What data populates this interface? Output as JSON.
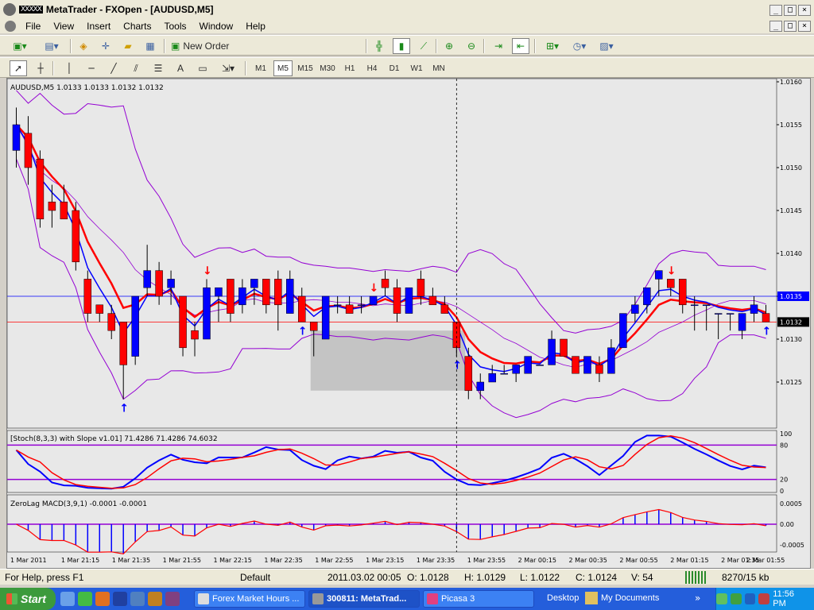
{
  "window": {
    "title": "MetaTrader - FXOpen - [AUDUSD,M5]",
    "title_mark": "XXXXX",
    "controls": {
      "minimize": "_",
      "restore": "□",
      "close": "×"
    }
  },
  "menu": [
    "File",
    "View",
    "Insert",
    "Charts",
    "Tools",
    "Window",
    "Help"
  ],
  "toolbar": {
    "new_order": "New Order",
    "timeframes": [
      "M1",
      "M5",
      "M15",
      "M30",
      "H1",
      "H4",
      "D1",
      "W1",
      "MN"
    ],
    "selected_timeframe": "M5"
  },
  "chart": {
    "symbol_info": "AUDUSD,M5  1.0133 1.0133 1.0132 1.0132",
    "stoch_label": "[Stoch(8,3,3) with Slope v1.01] 71.4286 71.4286 74.6032",
    "macd_label": "ZeroLag MACD(3,9,1) -0.0001 -0.0001",
    "price_ticks": [
      "1.0160",
      "1.0155",
      "1.0150",
      "1.0145",
      "1.0140",
      "1.0135",
      "1.0130",
      "1.0125"
    ],
    "current_price": "1.0132",
    "line_price_blue": "1.0135",
    "stoch_ticks": [
      "100",
      "80",
      "20",
      "0"
    ],
    "macd_ticks": [
      "0.0005",
      "0.00",
      "-0.0005"
    ],
    "time_ticks": [
      "1 Mar 2011",
      "1 Mar 21:15",
      "1 Mar 21:35",
      "1 Mar 21:55",
      "1 Mar 22:15",
      "1 Mar 22:35",
      "1 Mar 22:55",
      "1 Mar 23:15",
      "1 Mar 23:35",
      "1 Mar 23:55",
      "2 Mar 00:15",
      "2 Mar 00:35",
      "2 Mar 00:55",
      "2 Mar 01:15",
      "2 Mar 01:35",
      "2 Mar 01:55"
    ],
    "colors": {
      "bull": "#0000ff",
      "bear": "#ff0000",
      "band": "#9400d3",
      "ema": "#ff0000",
      "ema2": "#0000ff",
      "cyan": "#00e5ff"
    }
  },
  "chart_data": {
    "type": "candlestick",
    "symbol": "AUDUSD",
    "timeframe": "M5",
    "candles": [
      {
        "o": 1.0152,
        "h": 1.0157,
        "l": 1.015,
        "c": 1.0155
      },
      {
        "o": 1.0154,
        "h": 1.0156,
        "l": 1.0148,
        "c": 1.015
      },
      {
        "o": 1.0151,
        "h": 1.0152,
        "l": 1.0143,
        "c": 1.0144
      },
      {
        "o": 1.0146,
        "h": 1.0148,
        "l": 1.0143,
        "c": 1.0145
      },
      {
        "o": 1.0146,
        "h": 1.0148,
        "l": 1.0144,
        "c": 1.0144
      },
      {
        "o": 1.0145,
        "h": 1.0146,
        "l": 1.0138,
        "c": 1.0139
      },
      {
        "o": 1.0137,
        "h": 1.0138,
        "l": 1.0132,
        "c": 1.0133
      },
      {
        "o": 1.0134,
        "h": 1.0134,
        "l": 1.0132,
        "c": 1.0133
      },
      {
        "o": 1.0133,
        "h": 1.0134,
        "l": 1.013,
        "c": 1.0131
      },
      {
        "o": 1.0132,
        "h": 1.0132,
        "l": 1.0123,
        "c": 1.0127
      },
      {
        "o": 1.0128,
        "h": 1.0135,
        "l": 1.0127,
        "c": 1.0135
      },
      {
        "o": 1.0136,
        "h": 1.0141,
        "l": 1.0135,
        "c": 1.0138
      },
      {
        "o": 1.0138,
        "h": 1.0139,
        "l": 1.0134,
        "c": 1.0135
      },
      {
        "o": 1.0136,
        "h": 1.0138,
        "l": 1.0134,
        "c": 1.0137
      },
      {
        "o": 1.0135,
        "h": 1.0135,
        "l": 1.0128,
        "c": 1.0129
      },
      {
        "o": 1.0131,
        "h": 1.0132,
        "l": 1.0128,
        "c": 1.013
      },
      {
        "o": 1.013,
        "h": 1.0137,
        "l": 1.013,
        "c": 1.0136
      },
      {
        "o": 1.0135,
        "h": 1.0136,
        "l": 1.0132,
        "c": 1.0136
      },
      {
        "o": 1.0137,
        "h": 1.0137,
        "l": 1.0132,
        "c": 1.0133
      },
      {
        "o": 1.0134,
        "h": 1.0137,
        "l": 1.0133,
        "c": 1.0136
      },
      {
        "o": 1.0136,
        "h": 1.0137,
        "l": 1.0134,
        "c": 1.0137
      },
      {
        "o": 1.0137,
        "h": 1.0137,
        "l": 1.0133,
        "c": 1.0134
      },
      {
        "o": 1.0137,
        "h": 1.0138,
        "l": 1.0131,
        "c": 1.0134
      },
      {
        "o": 1.0133,
        "h": 1.0138,
        "l": 1.0133,
        "c": 1.0137
      },
      {
        "o": 1.0135,
        "h": 1.0136,
        "l": 1.0132,
        "c": 1.0132
      },
      {
        "o": 1.0132,
        "h": 1.0132,
        "l": 1.0128,
        "c": 1.0131
      },
      {
        "o": 1.013,
        "h": 1.0135,
        "l": 1.013,
        "c": 1.0135
      },
      {
        "o": 1.0134,
        "h": 1.0135,
        "l": 1.0133,
        "c": 1.0134
      },
      {
        "o": 1.0134,
        "h": 1.0135,
        "l": 1.0133,
        "c": 1.0133
      },
      {
        "o": 1.0134,
        "h": 1.0135,
        "l": 1.0133,
        "c": 1.0134
      },
      {
        "o": 1.0134,
        "h": 1.0135,
        "l": 1.0134,
        "c": 1.0135
      },
      {
        "o": 1.0137,
        "h": 1.0138,
        "l": 1.0135,
        "c": 1.0136
      },
      {
        "o": 1.0136,
        "h": 1.0137,
        "l": 1.0132,
        "c": 1.0133
      },
      {
        "o": 1.0133,
        "h": 1.0136,
        "l": 1.0133,
        "c": 1.0136
      },
      {
        "o": 1.0137,
        "h": 1.0138,
        "l": 1.0134,
        "c": 1.0135
      },
      {
        "o": 1.0135,
        "h": 1.0136,
        "l": 1.0134,
        "c": 1.0134
      },
      {
        "o": 1.0134,
        "h": 1.0135,
        "l": 1.0133,
        "c": 1.0133
      },
      {
        "o": 1.0132,
        "h": 1.0132,
        "l": 1.0128,
        "c": 1.0129
      },
      {
        "o": 1.0128,
        "h": 1.0129,
        "l": 1.0123,
        "c": 1.0124
      },
      {
        "o": 1.0124,
        "h": 1.0126,
        "l": 1.0123,
        "c": 1.0125
      },
      {
        "o": 1.0125,
        "h": 1.0127,
        "l": 1.0125,
        "c": 1.0126
      },
      {
        "o": 1.0126,
        "h": 1.0127,
        "l": 1.0126,
        "c": 1.0126
      },
      {
        "o": 1.0126,
        "h": 1.0127,
        "l": 1.0125,
        "c": 1.0127
      },
      {
        "o": 1.0126,
        "h": 1.0128,
        "l": 1.0126,
        "c": 1.0128
      },
      {
        "o": 1.0127,
        "h": 1.0127,
        "l": 1.0127,
        "c": 1.0127
      },
      {
        "o": 1.0127,
        "h": 1.0131,
        "l": 1.0127,
        "c": 1.013
      },
      {
        "o": 1.013,
        "h": 1.013,
        "l": 1.0128,
        "c": 1.0128
      },
      {
        "o": 1.0128,
        "h": 1.0128,
        "l": 1.0126,
        "c": 1.0126
      },
      {
        "o": 1.0126,
        "h": 1.0128,
        "l": 1.0126,
        "c": 1.0128
      },
      {
        "o": 1.0127,
        "h": 1.0128,
        "l": 1.0125,
        "c": 1.0126
      },
      {
        "o": 1.0126,
        "h": 1.013,
        "l": 1.0126,
        "c": 1.0129
      },
      {
        "o": 1.0129,
        "h": 1.0133,
        "l": 1.0129,
        "c": 1.0133
      },
      {
        "o": 1.0133,
        "h": 1.0135,
        "l": 1.0132,
        "c": 1.0134
      },
      {
        "o": 1.0134,
        "h": 1.0136,
        "l": 1.0133,
        "c": 1.0136
      },
      {
        "o": 1.0137,
        "h": 1.0138,
        "l": 1.0135,
        "c": 1.0138
      },
      {
        "o": 1.0137,
        "h": 1.0137,
        "l": 1.0135,
        "c": 1.0136
      },
      {
        "o": 1.0137,
        "h": 1.0137,
        "l": 1.0133,
        "c": 1.0134
      },
      {
        "o": 1.0134,
        "h": 1.0135,
        "l": 1.0131,
        "c": 1.0134
      },
      {
        "o": 1.0134,
        "h": 1.0134,
        "l": 1.0131,
        "c": 1.0134
      },
      {
        "o": 1.0133,
        "h": 1.0133,
        "l": 1.013,
        "c": 1.0133
      },
      {
        "o": 1.0133,
        "h": 1.0133,
        "l": 1.0131,
        "c": 1.0133
      },
      {
        "o": 1.0131,
        "h": 1.0133,
        "l": 1.013,
        "c": 1.0133
      },
      {
        "o": 1.0133,
        "h": 1.0135,
        "l": 1.0132,
        "c": 1.0134
      },
      {
        "o": 1.0133,
        "h": 1.0134,
        "l": 1.0132,
        "c": 1.0132
      }
    ],
    "ylim": [
      1.012,
      1.016
    ],
    "stoch_ylim": [
      0,
      100
    ],
    "macd_ylim": [
      -0.0006,
      0.0006
    ]
  }
}
